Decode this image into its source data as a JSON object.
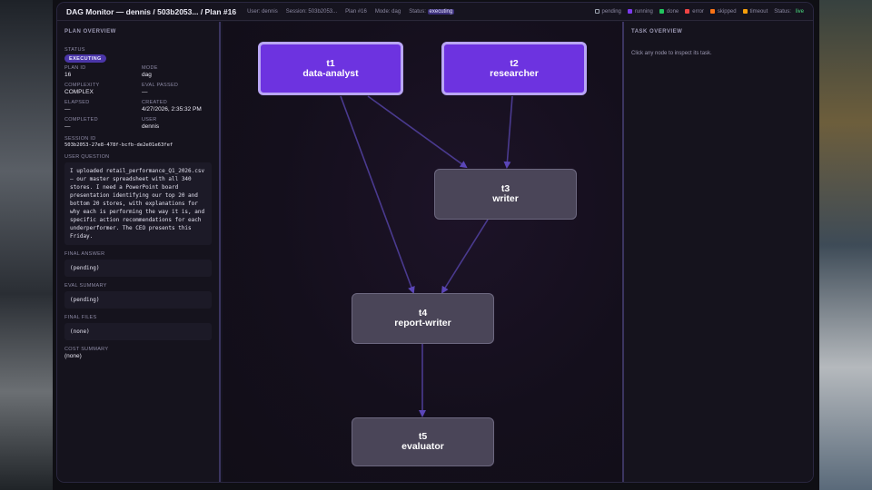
{
  "topbar": {
    "title": "DAG Monitor — dennis / 503b2053... / Plan #16",
    "user": "User: dennis",
    "session": "Session: 503b2053...",
    "plan": "Plan #16",
    "mode": "Mode: dag",
    "status_label": "Status:",
    "status_value": "executing",
    "legend": [
      {
        "label": "pending",
        "color": "#9ca3af"
      },
      {
        "label": "running",
        "color": "#7c3aed"
      },
      {
        "label": "done",
        "color": "#22c55e"
      },
      {
        "label": "error",
        "color": "#ef4444"
      },
      {
        "label": "skipped",
        "color": "#f97316"
      },
      {
        "label": "timeout",
        "color": "#f59e0b"
      }
    ],
    "live_label": "Status:",
    "live_value": "live"
  },
  "overview": {
    "title": "PLAN OVERVIEW",
    "status_label": "STATUS",
    "status_badge": "EXECUTING",
    "plan_id_label": "PLAN ID",
    "plan_id": "16",
    "mode_label": "MODE",
    "mode": "dag",
    "complexity_label": "COMPLEXITY",
    "complexity": "COMPLEX",
    "eval_passed_label": "EVAL PASSED",
    "eval_passed": "—",
    "elapsed_label": "ELAPSED",
    "elapsed": "—",
    "created_label": "CREATED",
    "created": "4/27/2026, 2:35:32 PM",
    "completed_label": "COMPLETED",
    "completed": "—",
    "user_label": "USER",
    "user": "dennis",
    "session_label": "SESSION ID",
    "session_id": "503b2053-27e8-478f-bcfb-de2e01e63fef",
    "question_label": "USER QUESTION",
    "question": "I uploaded retail_performance_Q1_2026.csv — our master spreadsheet with all 340 stores. I need a PowerPoint board presentation identifying our top 20 and bottom 20 stores, with explanations for why each is performing the way it is, and specific action recommendations for each underperformer. The CEO presents this Friday.",
    "final_answer_label": "FINAL ANSWER",
    "final_answer": "(pending)",
    "eval_summary_label": "EVAL SUMMARY",
    "eval_summary": "(pending)",
    "final_files_label": "FINAL FILES",
    "final_files": "(none)",
    "cost_label": "COST SUMMARY",
    "cost": "(none)"
  },
  "nodes": [
    {
      "id": "t1",
      "name": "data-analyst",
      "status": "running"
    },
    {
      "id": "t2",
      "name": "researcher",
      "status": "running"
    },
    {
      "id": "t3",
      "name": "writer",
      "status": "pending"
    },
    {
      "id": "t4",
      "name": "report-writer",
      "status": "pending"
    },
    {
      "id": "t5",
      "name": "evaluator",
      "status": "pending"
    }
  ],
  "task_overview": {
    "title": "TASK OVERVIEW",
    "hint": "Click any node to inspect its task."
  }
}
